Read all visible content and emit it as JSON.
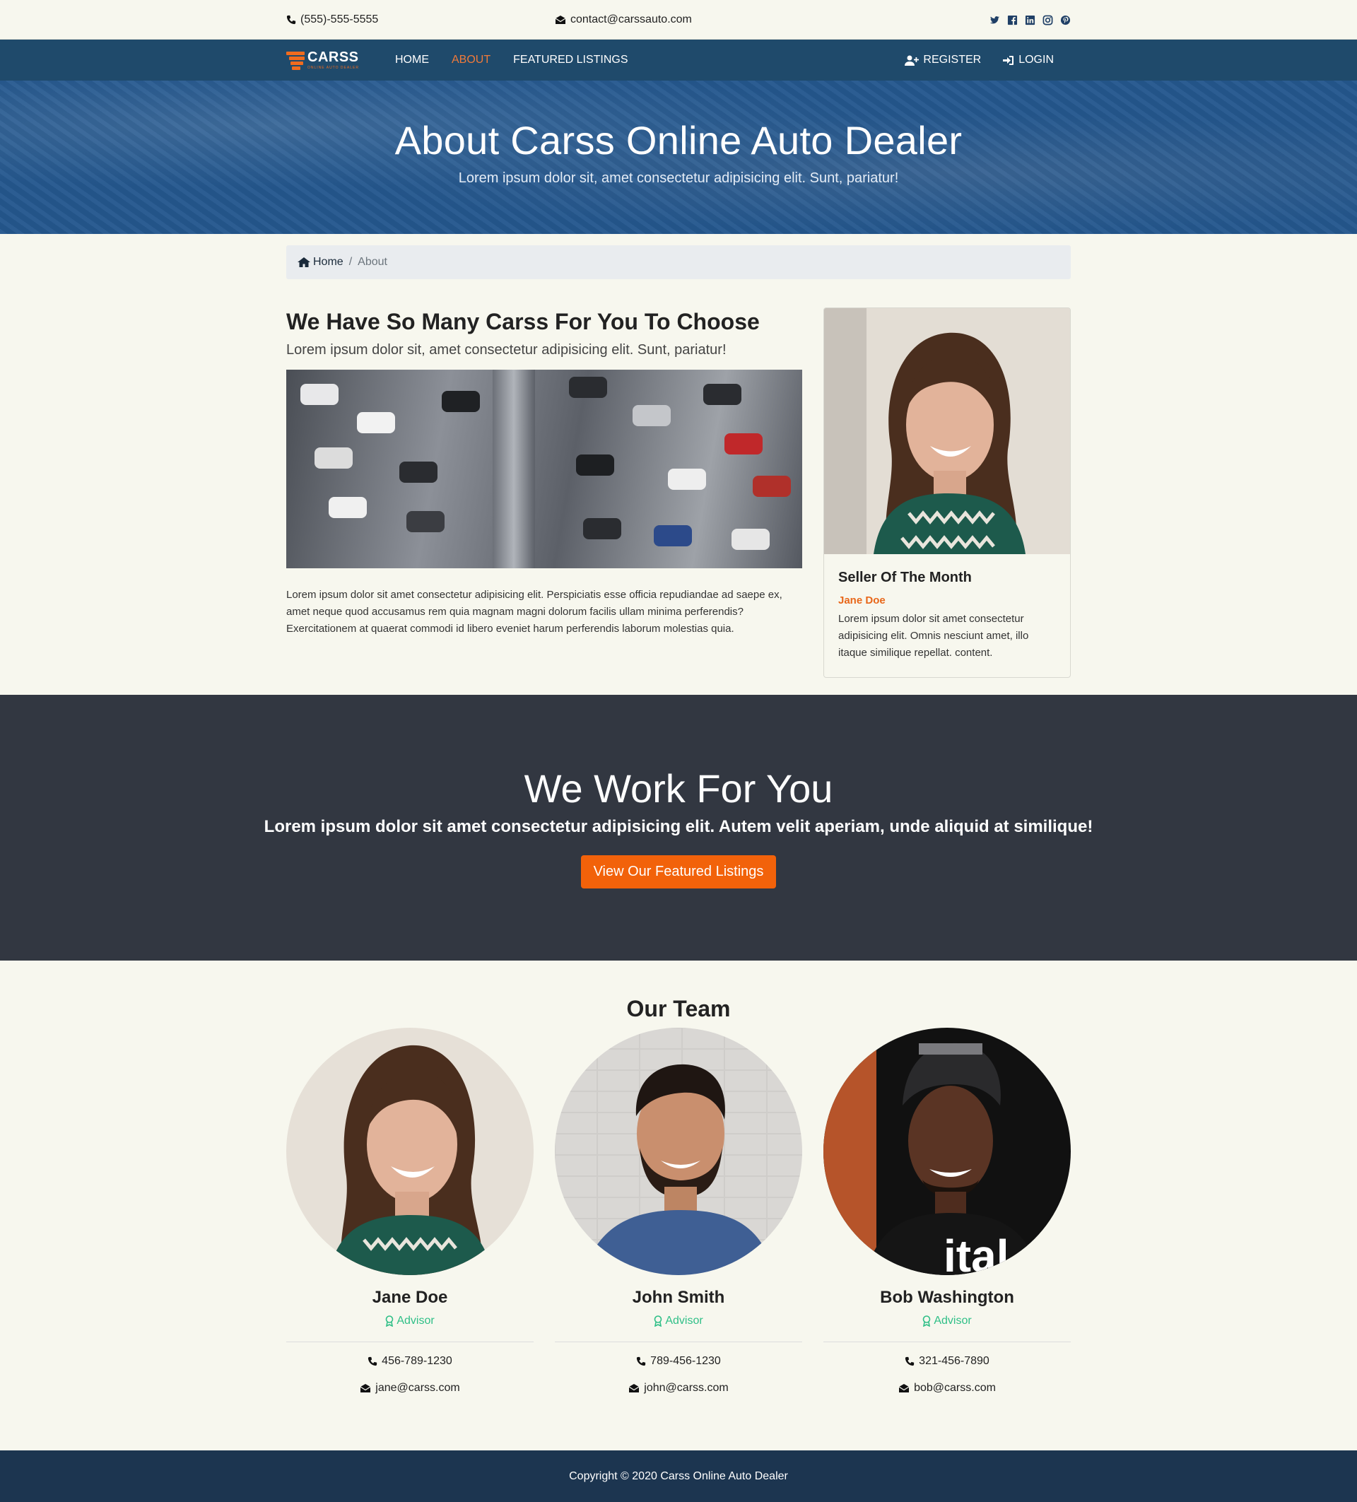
{
  "topbar": {
    "phone": "(555)-555-5555",
    "email": "contact@carssauto.com",
    "social": [
      "twitter-icon",
      "facebook-icon",
      "linkedin-icon",
      "instagram-icon",
      "pinterest-icon"
    ]
  },
  "nav": {
    "brand": "CARSS",
    "brand_sub": "ONLINE AUTO DEALER",
    "links": [
      "HOME",
      "ABOUT",
      "FEATURED LISTINGS"
    ],
    "active": "ABOUT",
    "register": "REGISTER",
    "login": "LOGIN"
  },
  "hero": {
    "title": "About Carss Online Auto Dealer",
    "subtitle": "Lorem ipsum dolor sit, amet consectetur adipisicing elit. Sunt, pariatur!"
  },
  "breadcrumb": {
    "home": "Home",
    "current": "About"
  },
  "about": {
    "heading": "We Have So Many Carss For You To Choose",
    "lead": "Lorem ipsum dolor sit, amet consectetur adipisicing elit. Sunt, pariatur!",
    "body": "Lorem ipsum dolor sit amet consectetur adipisicing elit. Perspiciatis esse officia repudiandae ad saepe ex, amet neque quod accusamus rem quia magnam magni dolorum facilis ullam minima perferendis? Exercitationem at quaerat commodi id libero eveniet harum perferendis laborum molestias quia."
  },
  "seller": {
    "title": "Seller Of The Month",
    "name": "Jane Doe",
    "desc": "Lorem ipsum dolor sit amet consectetur adipisicing elit. Omnis nesciunt amet, illo itaque similique repellat. content."
  },
  "cta": {
    "title": "We Work For You",
    "subtitle": "Lorem ipsum dolor sit amet consectetur adipisicing elit. Autem velit aperiam, unde aliquid at similique!",
    "button": "View Our Featured Listings"
  },
  "team": {
    "heading": "Our Team",
    "members": [
      {
        "name": "Jane Doe",
        "role": "Advisor",
        "phone": "456-789-1230",
        "email": "jane@carss.com"
      },
      {
        "name": "John Smith",
        "role": "Advisor",
        "phone": "789-456-1230",
        "email": "john@carss.com"
      },
      {
        "name": "Bob Washington",
        "role": "Advisor",
        "phone": "321-456-7890",
        "email": "bob@carss.com"
      }
    ]
  },
  "footer": {
    "copyright": "Copyright © 2020 Carss Online Auto Dealer"
  },
  "colors": {
    "accent": "#f2620a",
    "nav": "#1f4a6b",
    "hero": "#24578e",
    "dark": "#323741",
    "footer": "#1c3550",
    "role": "#2fbf87"
  }
}
